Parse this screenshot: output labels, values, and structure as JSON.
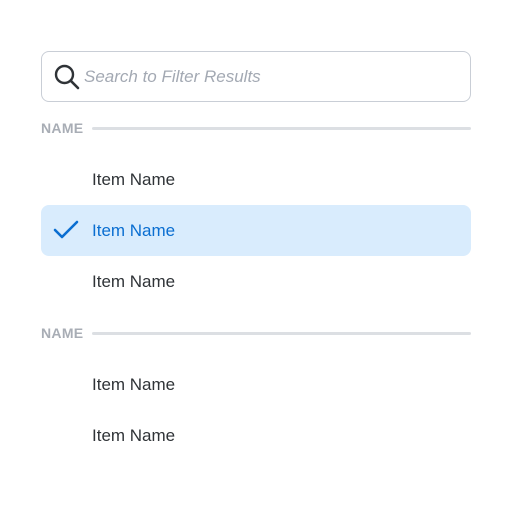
{
  "search": {
    "placeholder": "Search to Filter Results",
    "value": "",
    "icon": "search-icon"
  },
  "groups": [
    {
      "label": "NAME",
      "items": [
        {
          "label": "Item Name",
          "selected": false
        },
        {
          "label": "Item Name",
          "selected": true
        },
        {
          "label": "Item Name",
          "selected": false
        }
      ]
    },
    {
      "label": "NAME",
      "items": [
        {
          "label": "Item Name",
          "selected": false
        },
        {
          "label": "Item Name",
          "selected": false
        }
      ]
    }
  ],
  "colors": {
    "selected_background": "#d9ecfd",
    "selected_text": "#0a6ed1",
    "check_icon": "#0a6ed1",
    "section_label": "#a8adb5"
  }
}
